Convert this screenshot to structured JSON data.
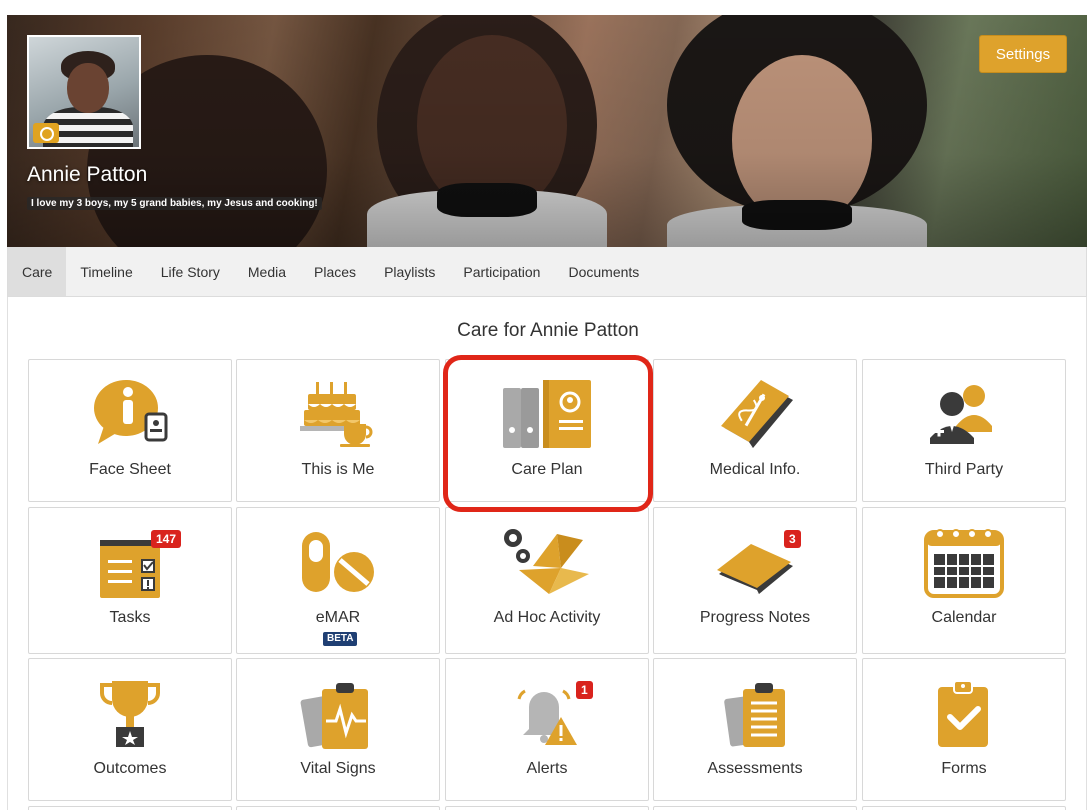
{
  "header": {
    "name": "Annie Patton",
    "bio": "I love my 3 boys, my 5 grand babies, my Jesus and cooking!",
    "settings_label": "Settings"
  },
  "tabs": [
    {
      "label": "Care",
      "active": true
    },
    {
      "label": "Timeline"
    },
    {
      "label": "Life Story"
    },
    {
      "label": "Media"
    },
    {
      "label": "Places"
    },
    {
      "label": "Playlists"
    },
    {
      "label": "Participation"
    },
    {
      "label": "Documents"
    }
  ],
  "care": {
    "title": "Care for Annie Patton",
    "tiles": [
      {
        "label": "Face Sheet",
        "icon": "info-bubble-icon"
      },
      {
        "label": "This is Me",
        "icon": "birthday-cake-icon"
      },
      {
        "label": "Care Plan",
        "icon": "binders-icon",
        "highlighted": true
      },
      {
        "label": "Medical Info.",
        "icon": "medical-book-icon"
      },
      {
        "label": "Third Party",
        "icon": "people-icon"
      },
      {
        "label": "Tasks",
        "icon": "task-board-icon",
        "badge": "147"
      },
      {
        "label": "eMAR",
        "icon": "pills-icon",
        "tag": "BETA"
      },
      {
        "label": "Ad Hoc Activity",
        "icon": "paper-crane-icon"
      },
      {
        "label": "Progress Notes",
        "icon": "notepad-icon",
        "badge": "3"
      },
      {
        "label": "Calendar",
        "icon": "calendar-icon"
      },
      {
        "label": "Outcomes",
        "icon": "trophy-icon"
      },
      {
        "label": "Vital Signs",
        "icon": "vital-signs-icon"
      },
      {
        "label": "Alerts",
        "icon": "bell-alert-icon",
        "badge": "1"
      },
      {
        "label": "Assessments",
        "icon": "clipboards-icon"
      },
      {
        "label": "Forms",
        "icon": "checklist-form-icon"
      }
    ]
  },
  "colors": {
    "accent": "#dea22c",
    "badge": "#d9231d",
    "icon_gray": "#9a9a9a",
    "highlight": "#e02618"
  }
}
